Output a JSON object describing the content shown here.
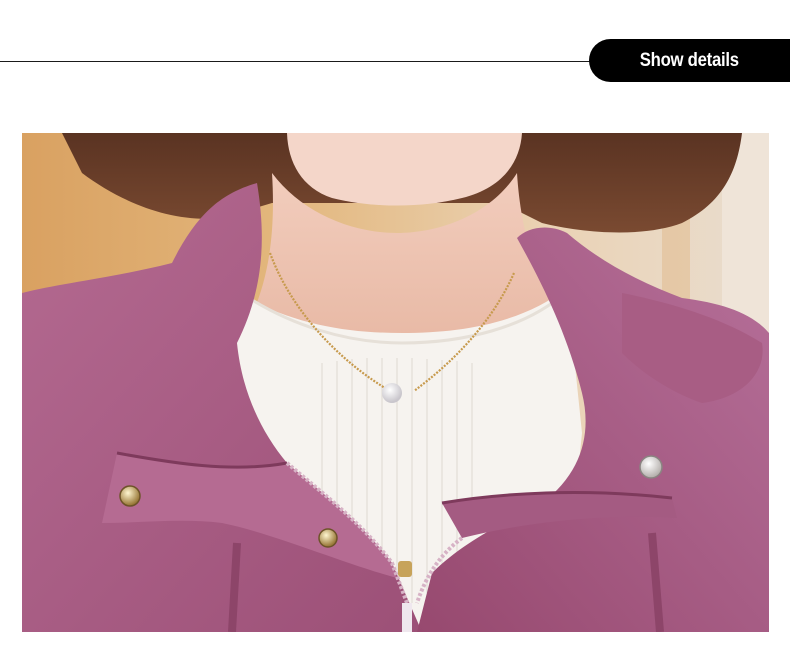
{
  "header": {
    "section_label": "Show details"
  },
  "photo": {
    "subject": "product-photo",
    "colors": {
      "jacket": "#a5587f",
      "sweater": "#f6f3ef",
      "hair": "#6a3f2a",
      "background": "#d9a56a",
      "pill": "#000000"
    }
  }
}
